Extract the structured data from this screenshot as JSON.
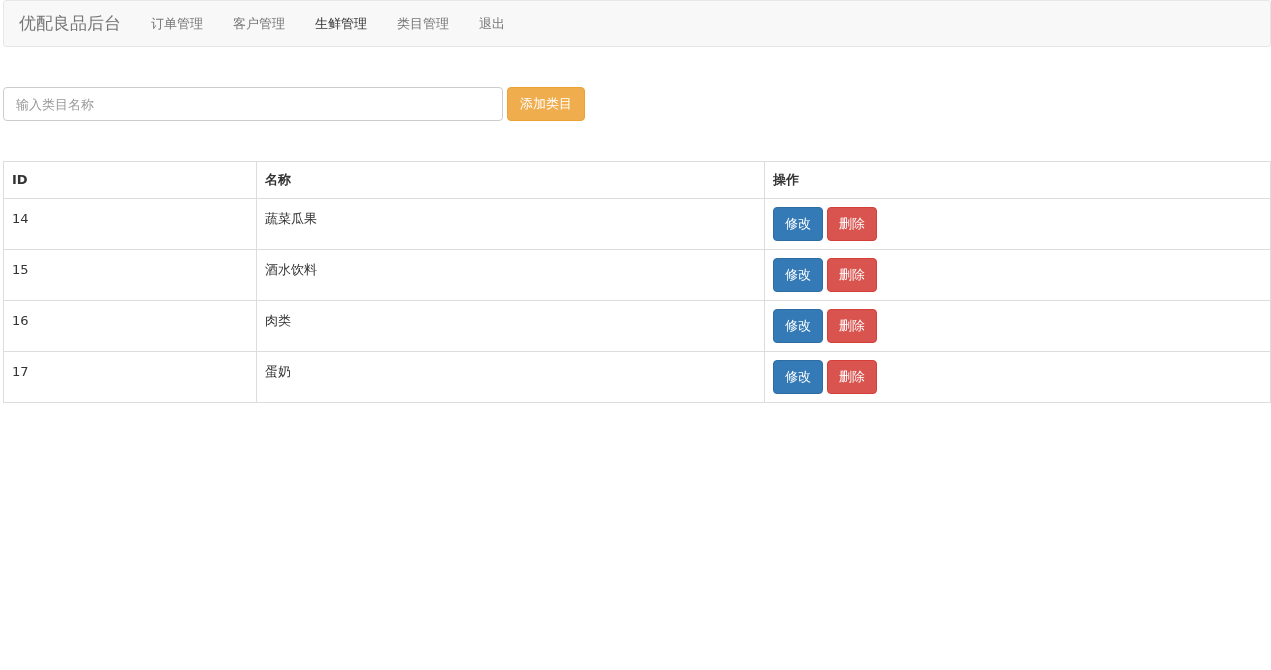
{
  "navbar": {
    "brand": "优配良品后台",
    "items": [
      {
        "label": "订单管理",
        "selected": false
      },
      {
        "label": "客户管理",
        "selected": false
      },
      {
        "label": "生鲜管理",
        "selected": true
      },
      {
        "label": "类目管理",
        "selected": false
      },
      {
        "label": "退出",
        "selected": false
      }
    ]
  },
  "add_form": {
    "placeholder": "输入类目名称",
    "button": "添加类目"
  },
  "table": {
    "columns": [
      "ID",
      "名称",
      "操作"
    ],
    "rows": [
      {
        "id": "14",
        "name": "蔬菜瓜果",
        "actions": [
          {
            "kind": "edit",
            "label": "修改"
          },
          {
            "kind": "delete",
            "label": "删除"
          }
        ]
      },
      {
        "id": "15",
        "name": "酒水饮料",
        "actions": [
          {
            "kind": "edit",
            "label": "修改"
          },
          {
            "kind": "delete",
            "label": "删除"
          }
        ]
      },
      {
        "id": "16",
        "name": "肉类",
        "actions": [
          {
            "kind": "edit",
            "label": "修改"
          },
          {
            "kind": "delete",
            "label": "删除"
          }
        ]
      },
      {
        "id": "17",
        "name": "蛋奶",
        "actions": [
          {
            "kind": "edit",
            "label": "修改"
          },
          {
            "kind": "delete",
            "label": "删除"
          }
        ]
      }
    ]
  }
}
